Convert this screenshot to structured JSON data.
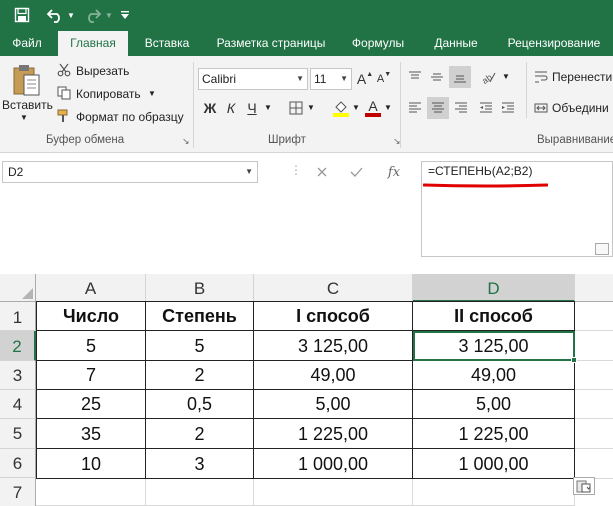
{
  "quick_access": {
    "save_icon": "save-icon",
    "undo_icon": "undo-icon",
    "undo_dropdown_icon": "chevron-down-icon",
    "redo_icon": "redo-icon",
    "redo_dropdown_icon": "chevron-down-icon",
    "customize_icon": "customize-icon"
  },
  "tabs": [
    "Файл",
    "Главная",
    "Вставка",
    "Разметка страницы",
    "Формулы",
    "Данные",
    "Рецензирование"
  ],
  "active_tab": "Главная",
  "ribbon": {
    "clipboard": {
      "paste_label": "Вставить",
      "cut_label": "Вырезать",
      "copy_label": "Копировать",
      "format_painter_label": "Формат по образцу",
      "group_label": "Буфер обмена"
    },
    "font": {
      "font_name": "Calibri",
      "font_size": "11",
      "grow_label": "A",
      "shrink_label": "A",
      "bold_label": "Ж",
      "italic_label": "К",
      "underline_label": "Ч",
      "font_color_label": "A",
      "group_label": "Шрифт"
    },
    "alignment": {
      "wrap_label": "Перенести",
      "merge_label": "Объедини",
      "group_label": "Выравнивание"
    },
    "colors": {
      "accent": "#217346",
      "highlight": "#ffff00",
      "font_color": "#c00000"
    }
  },
  "formula_bar": {
    "name_box": "D2",
    "formula": "=СТЕПЕНЬ(A2;B2)",
    "cancel_icon": "close-icon",
    "enter_icon": "check-icon",
    "fx_label": "fx",
    "underline_color": "#e00000"
  },
  "sheet": {
    "columns": [
      "A",
      "B",
      "C",
      "D"
    ],
    "selected_column": "D",
    "selected_row": "2",
    "rows": [
      {
        "num": "1",
        "cells": [
          "Число",
          "Степень",
          "I способ",
          "II способ"
        ]
      },
      {
        "num": "2",
        "cells": [
          "5",
          "5",
          "3 125,00",
          "3 125,00"
        ]
      },
      {
        "num": "3",
        "cells": [
          "7",
          "2",
          "49,00",
          "49,00"
        ]
      },
      {
        "num": "4",
        "cells": [
          "25",
          "0,5",
          "5,00",
          "5,00"
        ]
      },
      {
        "num": "5",
        "cells": [
          "35",
          "2",
          "1 225,00",
          "1 225,00"
        ]
      },
      {
        "num": "6",
        "cells": [
          "10",
          "3",
          "1 000,00",
          "1 000,00"
        ]
      },
      {
        "num": "7",
        "cells": [
          "",
          "",
          "",
          ""
        ]
      }
    ]
  }
}
